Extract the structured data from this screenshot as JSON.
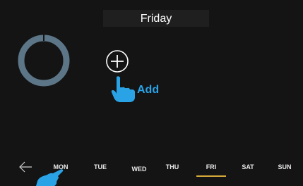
{
  "header": {
    "day_title": "Friday"
  },
  "add_action": {
    "label": "Add"
  },
  "day_tabs": [
    "MON",
    "TUE",
    "WED",
    "THU",
    "FRI",
    "SAT",
    "SUN"
  ],
  "selected_day": "FRI",
  "colors": {
    "background": "#141414",
    "header_bg": "#1f1f1f",
    "ring": "#5c7688",
    "accent_blue": "#2aa3e6",
    "active_tab_underline": "#d6a93a"
  },
  "icons": {
    "back": "left-arrow-icon",
    "add": "plus-circle-icon",
    "pointer": "pointing-hand-icon",
    "progress": "ring-icon"
  }
}
